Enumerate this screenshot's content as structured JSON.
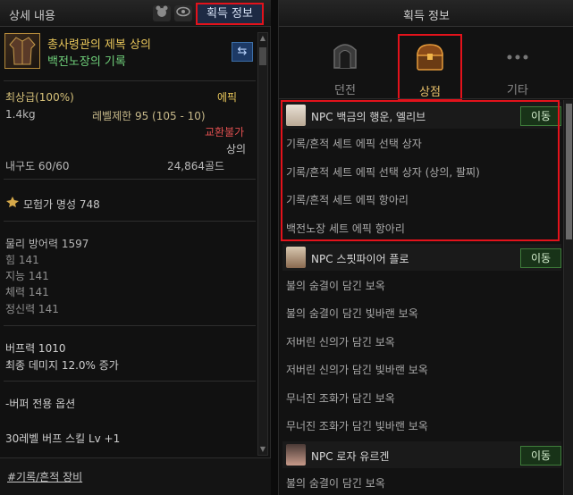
{
  "left_panel": {
    "title": "상세 내용",
    "header_icons": [
      "bear-icon",
      "eye-icon"
    ],
    "acquire_button": "획득 정보",
    "item": {
      "name_line1": "총사령관의 제복 상의",
      "name_line2": "백전노장의 기록",
      "icon": "coat-icon",
      "swap_button_icon": "swap-icon"
    },
    "grade": "최상급(100%)",
    "rarity": "에픽",
    "weight": "1.4kg",
    "level_limit": "레벨제한 95 (105 - 10)",
    "trade": "교환불가",
    "slot": "상의",
    "durability": "내구도 60/60",
    "price": "24,864골드",
    "fame": "모험가 명성 748",
    "stats": {
      "phys_def": "물리 방어력 1597",
      "str": "힘 141",
      "int": "지능 141",
      "vit": "체력 141",
      "spr": "정신력 141"
    },
    "buff_power": "버프력 1010",
    "final_damage": "최종 데미지 12.0% 증가",
    "buffer_option": "-버퍼 전용 옵션",
    "buff_skill": "30레벨 버프 스킬 Lv +1",
    "footer_link": "#기록/흔적 장비"
  },
  "right_panel": {
    "title": "획득 정보",
    "tabs": [
      {
        "label": "던전",
        "icon": "dungeon-gate-icon",
        "active": false
      },
      {
        "label": "상점",
        "icon": "chest-icon",
        "active": true
      },
      {
        "label": "기타",
        "icon": "more-dots-icon",
        "active": false
      }
    ],
    "move_label": "이동",
    "npcs": [
      {
        "name": "NPC 백금의 행운, 엘리브",
        "items": [
          "기록/흔적 세트 에픽 선택 상자",
          "기록/흔적 세트 에픽 선택 상자 (상의, 팔찌)",
          "기록/흔적 세트 에픽 항아리",
          "백전노장 세트 에픽 항아리"
        ]
      },
      {
        "name": "NPC 스핏파이어 플로",
        "items": [
          "불의 숨결이 담긴 보옥",
          "불의 숨결이 담긴 빛바랜 보옥",
          "저버린 신의가 담긴 보옥",
          "저버린 신의가 담긴 빛바랜 보옥",
          "무너진 조화가 담긴 보옥",
          "무너진 조화가 담긴 빛바랜 보옥"
        ]
      },
      {
        "name": "NPC 로자 유르겐",
        "items": [
          "불의 숨결이 담긴 보옥"
        ]
      }
    ]
  },
  "colors": {
    "highlight": "#e3121b",
    "epic": "#e8c65a",
    "set": "#6fd07a",
    "untradeable": "#e05050"
  }
}
